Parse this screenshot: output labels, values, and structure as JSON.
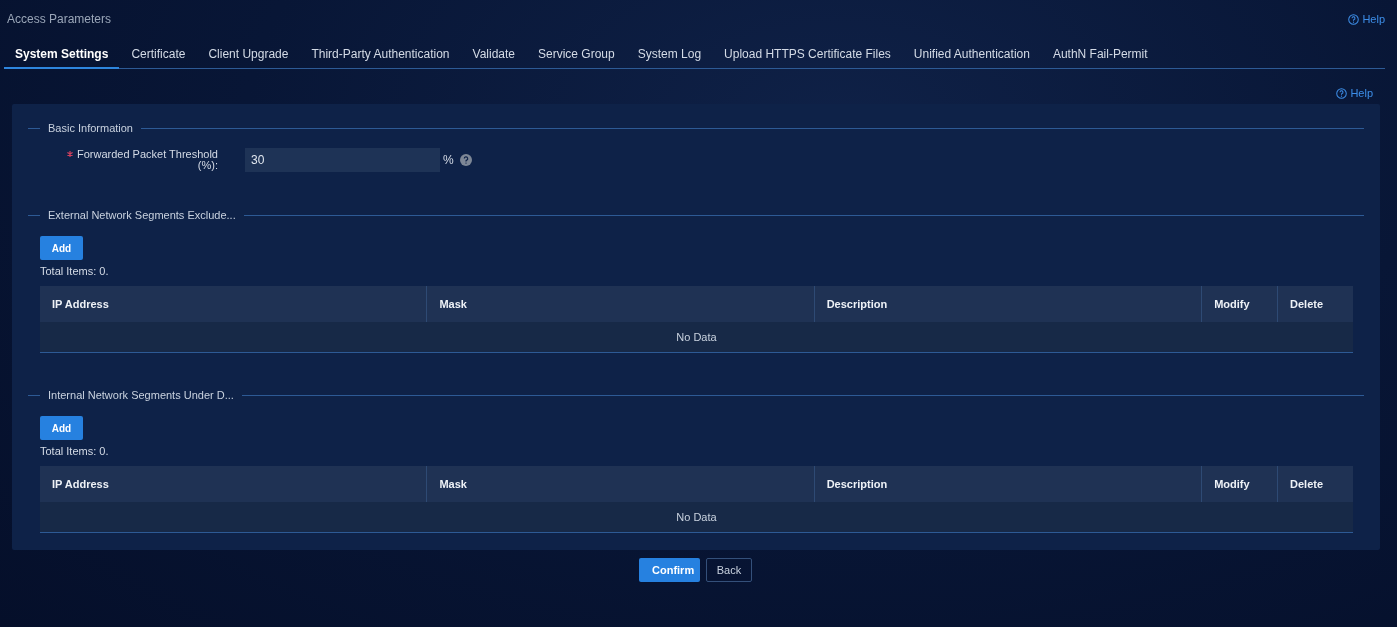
{
  "page": {
    "title": "Access Parameters",
    "help": "Help"
  },
  "tabs": [
    {
      "label": "System Settings",
      "selected": true
    },
    {
      "label": "Certificate",
      "selected": false
    },
    {
      "label": "Client Upgrade",
      "selected": false
    },
    {
      "label": "Third-Party Authentication",
      "selected": false
    },
    {
      "label": "Validate",
      "selected": false
    },
    {
      "label": "Service Group",
      "selected": false
    },
    {
      "label": "System Log",
      "selected": false
    },
    {
      "label": "Upload HTTPS Certificate Files",
      "selected": false
    },
    {
      "label": "Unified Authentication",
      "selected": false
    },
    {
      "label": "AuthN Fail-Permit",
      "selected": false
    }
  ],
  "panel_help": "Help",
  "sections": [
    {
      "kind": "form",
      "title": "Basic Information",
      "fields": [
        {
          "required": true,
          "label": "Forwarded Packet Threshold (%):",
          "value": "30",
          "unit": "%"
        }
      ]
    },
    {
      "kind": "table",
      "title": "External Network Segments Exclude...",
      "add": "Add",
      "total": "Total Items: 0.",
      "columns": [
        "IP Address",
        "Mask",
        "Description",
        "Modify",
        "Delete"
      ],
      "empty": "No Data"
    },
    {
      "kind": "table",
      "title": "Internal Network Segments Under D...",
      "add": "Add",
      "total": "Total Items: 0.",
      "columns": [
        "IP Address",
        "Mask",
        "Description",
        "Modify",
        "Delete"
      ],
      "empty": "No Data"
    }
  ],
  "buttons": [
    {
      "label": "Confirm",
      "kind": "primary"
    },
    {
      "label": "Back",
      "kind": "secondary"
    }
  ]
}
